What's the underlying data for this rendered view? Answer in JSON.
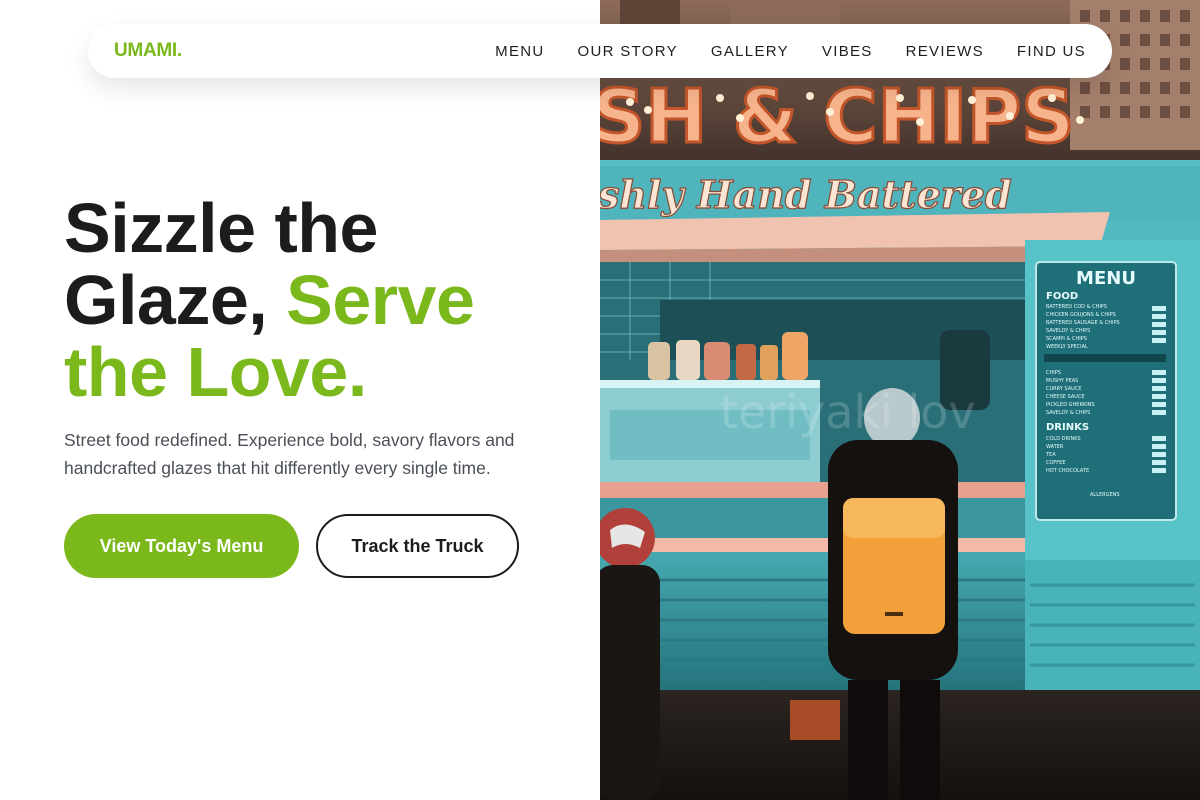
{
  "brand": {
    "logo": "UMAMI."
  },
  "nav": {
    "items": [
      {
        "label": "MENU"
      },
      {
        "label": "OUR STORY"
      },
      {
        "label": "GALLERY"
      },
      {
        "label": "VIBES"
      },
      {
        "label": "REVIEWS"
      },
      {
        "label": "FIND US"
      }
    ]
  },
  "hero": {
    "headline_part1": "Sizzle the",
    "headline_part2": "Glaze, ",
    "headline_accent1": "Serve",
    "headline_accent2": "the Love.",
    "subtext": "Street food redefined. Experience bold, savory flavors and handcrafted glazes that hit differently every single time.",
    "primary_cta": "View Today's Menu",
    "secondary_cta": "Track the Truck"
  },
  "photo": {
    "sign_text": "SH & CHIPS",
    "script_text": "shly Hand Battered",
    "menu_board": {
      "title": "MENU",
      "food_heading": "FOOD",
      "food_items": [
        "BATTERED COD & CHIPS",
        "CHICKEN GOUJONS & CHIPS",
        "BATTERED SAUSAGE & CHIPS",
        "SAVELOY & CHIPS",
        "SCAMPI & CHIPS",
        "WEEKLY SPECIAL"
      ],
      "sides": [
        "CHIPS",
        "MUSHY PEAS",
        "CURRY SAUCE",
        "CHEESE SAUCE",
        "PICKLED GHERKINS",
        "SAVELOY & CHIPS"
      ],
      "drinks_heading": "DRINKS",
      "drinks_items": [
        "COLD DRINKS",
        "WATER",
        "TEA",
        "COFFEE",
        "HOT CHOCOLATE"
      ],
      "allergens": "ALLERGENS"
    },
    "colors": {
      "truck_teal": "#3fa8b0",
      "sign_glow": "#f3b48a",
      "backpack": "#f2a03a"
    }
  },
  "theme": {
    "accent": "#7bb81c",
    "text_dark": "#1c1c1c",
    "text_muted": "#4a4f57"
  }
}
